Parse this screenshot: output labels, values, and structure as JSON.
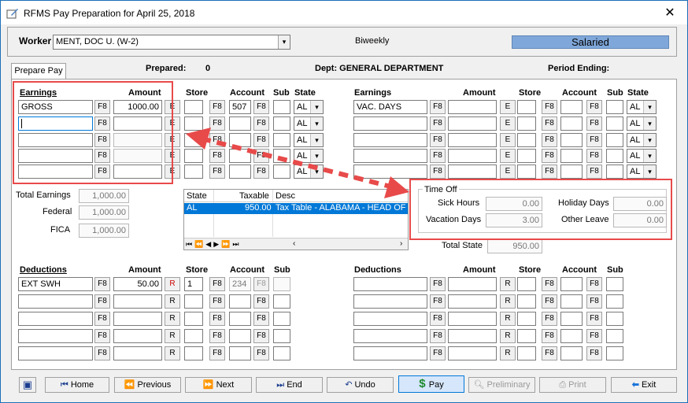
{
  "window": {
    "title": "RFMS Pay Preparation for April 25, 2018",
    "close_glyph": "✕"
  },
  "worker": {
    "label": "Worker",
    "value": "MENT, DOC U. (W-2)",
    "frequency": "Biweekly",
    "pay_type": "Salaried"
  },
  "tab": {
    "label": "Prepare Pay"
  },
  "info": {
    "prepared_label": "Prepared:",
    "prepared_value": "0",
    "dept": "Dept: GENERAL DEPARTMENT",
    "period_label": "Period Ending:"
  },
  "earn_headers": {
    "earnings": "Earnings",
    "amount": "Amount",
    "store": "Store",
    "account": "Account",
    "sub": "Sub",
    "state": "State"
  },
  "earnings_left": [
    {
      "name": "GROSS",
      "amount": "1000.00",
      "account": "507",
      "state": "AL"
    },
    {
      "name": "",
      "amount": "",
      "account": "",
      "state": "AL"
    },
    {
      "name": "",
      "amount": "",
      "account": "",
      "state": "AL"
    },
    {
      "name": "",
      "amount": "",
      "account": "",
      "state": "AL"
    },
    {
      "name": "",
      "amount": "",
      "account": "",
      "state": "AL"
    }
  ],
  "earnings_right": [
    {
      "name": "VAC. DAYS",
      "state": "AL"
    },
    {
      "name": "",
      "state": "AL"
    },
    {
      "name": "",
      "state": "AL"
    },
    {
      "name": "",
      "state": "AL"
    },
    {
      "name": "",
      "state": "AL"
    }
  ],
  "btn": {
    "f8": "F8",
    "e": "E",
    "r": "R"
  },
  "totals": {
    "total_earnings_label": "Total Earnings",
    "total_earnings": "1,000.00",
    "federal_label": "Federal",
    "federal": "1,000.00",
    "fica_label": "FICA",
    "fica": "1,000.00",
    "total_state_label": "Total State",
    "total_state": "950.00"
  },
  "state_grid": {
    "headers": [
      "State",
      "Taxable",
      "Desc"
    ],
    "row": {
      "state": "AL",
      "taxable": "950.00",
      "desc": "Tax Table - ALABAMA - HEAD OF H"
    }
  },
  "time_off": {
    "title": "Time Off",
    "sick_label": "Sick Hours",
    "sick": "0.00",
    "holiday_label": "Holiday Days",
    "holiday": "0.00",
    "vacation_label": "Vacation Days",
    "vacation": "3.00",
    "other_label": "Other Leave",
    "other": "0.00"
  },
  "ded_headers": {
    "deductions": "Deductions",
    "amount": "Amount",
    "store": "Store",
    "account": "Account",
    "sub": "Sub"
  },
  "deductions_left": [
    {
      "name": "EXT SWH",
      "amount": "50.00",
      "store": "1",
      "account": "234"
    },
    {
      "name": "",
      "amount": "",
      "store": "",
      "account": ""
    },
    {
      "name": "",
      "amount": "",
      "store": "",
      "account": ""
    },
    {
      "name": "",
      "amount": "",
      "store": "",
      "account": ""
    },
    {
      "name": "",
      "amount": "",
      "store": "",
      "account": ""
    }
  ],
  "toolbar": {
    "home": "Home",
    "previous": "Previous",
    "next": "Next",
    "end": "End",
    "undo": "Undo",
    "pay": "Pay",
    "preliminary": "Preliminary",
    "print": "Print",
    "exit": "Exit"
  },
  "colors": {
    "accent_red": "#e84a4a",
    "selection_blue": "#0078d7",
    "salaried_bg": "#7fa7d9"
  }
}
